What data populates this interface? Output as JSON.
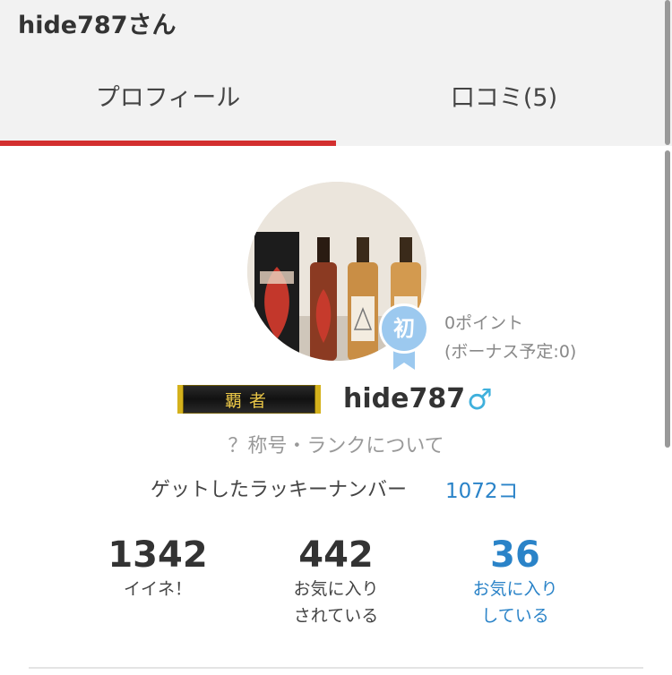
{
  "header": {
    "title": "hide787さん"
  },
  "tabs": [
    {
      "label": "プロフィール",
      "active": true
    },
    {
      "label": "口コミ(5)",
      "active": false
    }
  ],
  "colors": {
    "accent": "#d32f2f",
    "link": "#2a83c8",
    "badge": "#9cc9ef",
    "gender": "#3fb0dc"
  },
  "profile": {
    "badge_label": "初",
    "points": "0ポイント",
    "bonus": "(ボーナス予定:0)",
    "rank_title": "覇者",
    "username": "hide787",
    "gender_symbol": "♂",
    "rank_info_link": "？称号・ランクについて",
    "lucky_label": "ゲットしたラッキーナンバー",
    "lucky_count": "1072コ"
  },
  "stats": [
    {
      "value": "1342",
      "label_line1": "イイネ！",
      "label_line2": ""
    },
    {
      "value": "442",
      "label_line1": "お気に入り",
      "label_line2": "されている"
    },
    {
      "value": "36",
      "label_line1": "お気に入り",
      "label_line2": "している"
    }
  ]
}
